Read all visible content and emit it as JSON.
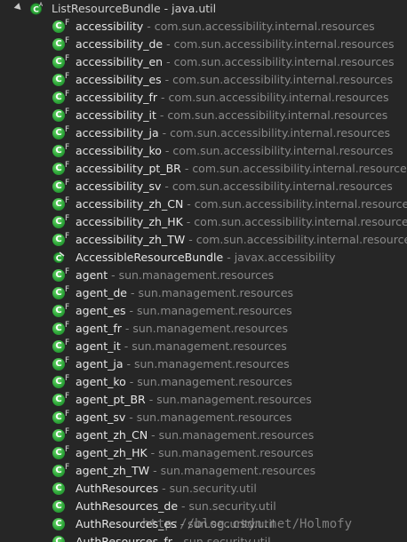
{
  "root": {
    "label": "ListResourceBundle - java.util"
  },
  "items": [
    {
      "name": "accessibility",
      "pkg": "com.sun.accessibility.internal.resources",
      "icon": "class-final-icon"
    },
    {
      "name": "accessibility_de",
      "pkg": "com.sun.accessibility.internal.resources",
      "icon": "class-final-icon"
    },
    {
      "name": "accessibility_en",
      "pkg": "com.sun.accessibility.internal.resources",
      "icon": "class-final-icon"
    },
    {
      "name": "accessibility_es",
      "pkg": "com.sun.accessibility.internal.resources",
      "icon": "class-final-icon"
    },
    {
      "name": "accessibility_fr",
      "pkg": "com.sun.accessibility.internal.resources",
      "icon": "class-final-icon"
    },
    {
      "name": "accessibility_it",
      "pkg": "com.sun.accessibility.internal.resources",
      "icon": "class-final-icon"
    },
    {
      "name": "accessibility_ja",
      "pkg": "com.sun.accessibility.internal.resources",
      "icon": "class-final-icon"
    },
    {
      "name": "accessibility_ko",
      "pkg": "com.sun.accessibility.internal.resources",
      "icon": "class-final-icon"
    },
    {
      "name": "accessibility_pt_BR",
      "pkg": "com.sun.accessibility.internal.resources",
      "icon": "class-final-icon"
    },
    {
      "name": "accessibility_sv",
      "pkg": "com.sun.accessibility.internal.resources",
      "icon": "class-final-icon"
    },
    {
      "name": "accessibility_zh_CN",
      "pkg": "com.sun.accessibility.internal.resources",
      "icon": "class-final-icon"
    },
    {
      "name": "accessibility_zh_HK",
      "pkg": "com.sun.accessibility.internal.resources",
      "icon": "class-final-icon"
    },
    {
      "name": "accessibility_zh_TW",
      "pkg": "com.sun.accessibility.internal.resources",
      "icon": "class-final-icon"
    },
    {
      "name": "AccessibleResourceBundle",
      "pkg": "javax.accessibility",
      "icon": "abstract-class-icon"
    },
    {
      "name": "agent",
      "pkg": "sun.management.resources",
      "icon": "class-final-icon"
    },
    {
      "name": "agent_de",
      "pkg": "sun.management.resources",
      "icon": "class-final-icon"
    },
    {
      "name": "agent_es",
      "pkg": "sun.management.resources",
      "icon": "class-final-icon"
    },
    {
      "name": "agent_fr",
      "pkg": "sun.management.resources",
      "icon": "class-final-icon"
    },
    {
      "name": "agent_it",
      "pkg": "sun.management.resources",
      "icon": "class-final-icon"
    },
    {
      "name": "agent_ja",
      "pkg": "sun.management.resources",
      "icon": "class-final-icon"
    },
    {
      "name": "agent_ko",
      "pkg": "sun.management.resources",
      "icon": "class-final-icon"
    },
    {
      "name": "agent_pt_BR",
      "pkg": "sun.management.resources",
      "icon": "class-final-icon"
    },
    {
      "name": "agent_sv",
      "pkg": "sun.management.resources",
      "icon": "class-final-icon"
    },
    {
      "name": "agent_zh_CN",
      "pkg": "sun.management.resources",
      "icon": "class-final-icon"
    },
    {
      "name": "agent_zh_HK",
      "pkg": "sun.management.resources",
      "icon": "class-final-icon"
    },
    {
      "name": "agent_zh_TW",
      "pkg": "sun.management.resources",
      "icon": "class-final-icon"
    },
    {
      "name": "AuthResources",
      "pkg": "sun.security.util",
      "icon": "class-icon"
    },
    {
      "name": "AuthResources_de",
      "pkg": "sun.security.util",
      "icon": "class-icon"
    },
    {
      "name": "AuthResources_es",
      "pkg": "sun.security.util",
      "icon": "class-icon"
    },
    {
      "name": "AuthResources_fr",
      "pkg": "sun.security.util",
      "icon": "class-icon"
    }
  ],
  "separator": " - ",
  "watermark": "http://blog.csdn.net/Holmofy"
}
